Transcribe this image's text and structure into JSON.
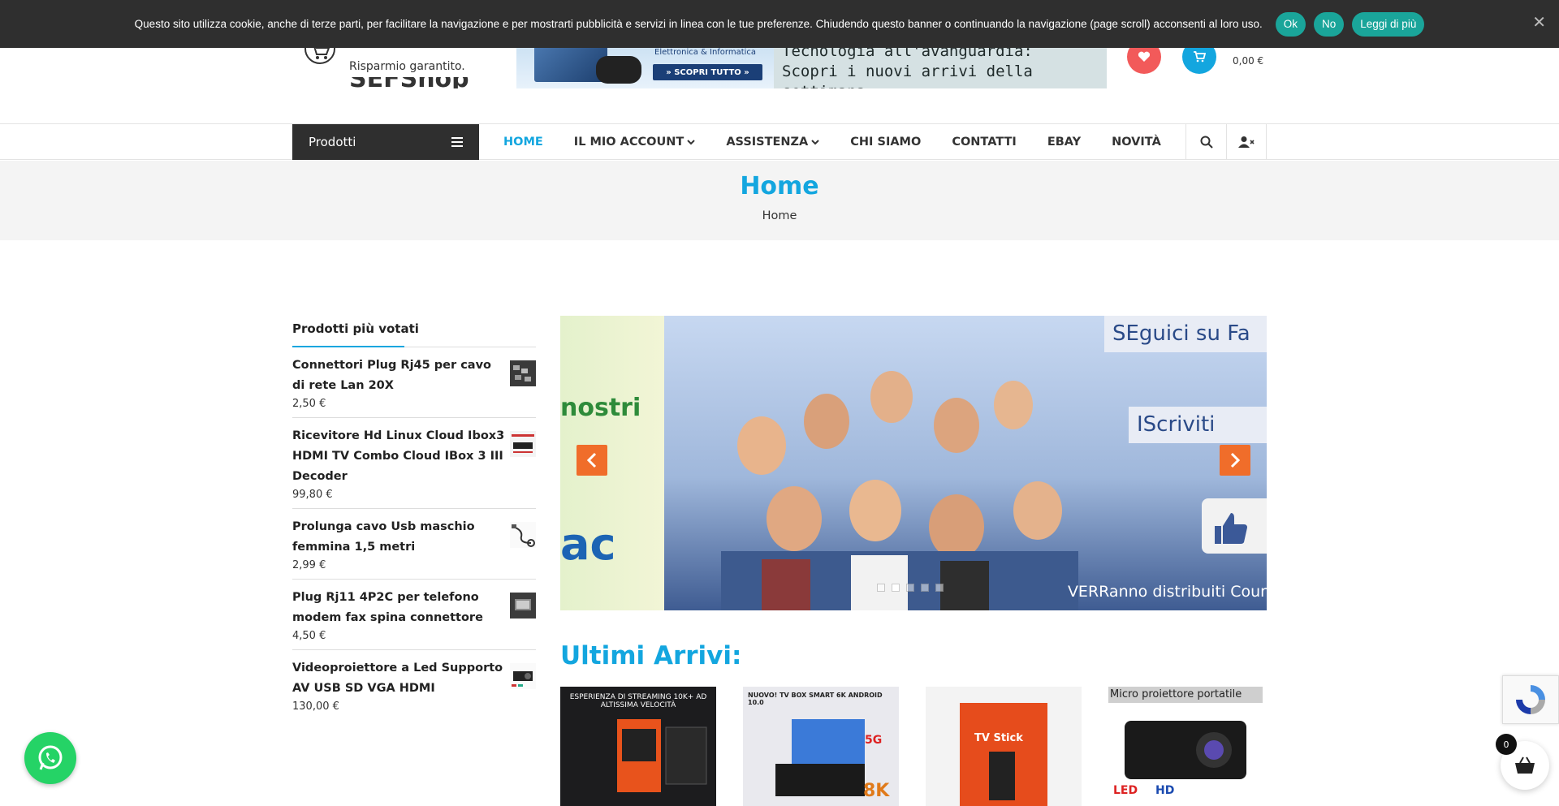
{
  "cookie": {
    "message": "Questo sito utilizza cookie, anche di terze parti, per facilitare la navigazione e per mostrarti pubblicità e servizi in linea con le tue preferenze. Chiudendo questo banner o continuando la navigazione (page scroll) acconsenti al loro uso.",
    "ok_label": "Ok",
    "no_label": "No",
    "more_label": "Leggi di più",
    "close_glyph": "✕",
    "accent": "#1aa59a"
  },
  "header": {
    "site_name": "SEFShop",
    "tagline": "Risparmio garantito.",
    "banner": {
      "category": "Elettronica & Informatica",
      "cta": "» SCOPRI TUTTO »",
      "line1": "Tecnologia all'avanguardia:",
      "line2": "Scopri i nuovi arrivi della settimana."
    },
    "cart_total": "0,00 €",
    "wishlist_color": "#f25a5a",
    "cart_color": "#13a6df"
  },
  "nav": {
    "category_label": "Prodotti",
    "items": [
      {
        "label": "HOME",
        "active": true
      },
      {
        "label": "IL MIO ACCOUNT",
        "dropdown": true
      },
      {
        "label": "ASSISTENZA",
        "dropdown": true
      },
      {
        "label": "CHI SIAMO"
      },
      {
        "label": "CONTATTI"
      },
      {
        "label": "EBAY"
      },
      {
        "label": "NOVITÀ"
      }
    ],
    "accent": "#13a6df"
  },
  "page": {
    "title": "Home",
    "breadcrumb": "Home"
  },
  "sidebar": {
    "title": "Prodotti più votati",
    "products": [
      {
        "name": "Connettori Plug Rj45 per cavo di rete Lan 20X",
        "price": "2,50 €"
      },
      {
        "name": "Ricevitore Hd Linux Cloud Ibox3 HDMI TV Combo Cloud IBox 3 III Decoder",
        "price": "99,80 €"
      },
      {
        "name": "Prolunga cavo Usb maschio femmina 1,5 metri",
        "price": "2,99 €"
      },
      {
        "name": "Plug Rj11 4P2C per telefono modem fax spina connettore",
        "price": "4,50 €"
      },
      {
        "name": "Videoproiettore a Led Supporto AV USB SD VGA HDMI",
        "price": "130,00 €"
      }
    ]
  },
  "slider": {
    "prev_text1": "nostri",
    "prev_text2": "ac",
    "fb_line1": "SEguici su Fa",
    "fb_line2": "IScriviti",
    "fb_bottom": "VERRanno distribuiti Cour",
    "fb_like": "Mi",
    "arrow_color": "#f06d2a",
    "slide_count": 5,
    "active_slide": 2
  },
  "latest": {
    "title": "Ultimi Arrivi:",
    "cards": [
      {
        "caption": "ESPERIENZA DI STREAMING 10K+ AD ALTISSIMA VELOCITÀ"
      },
      {
        "caption": "NUOVO! TV BOX SMART 6K ANDROID 10.0"
      },
      {
        "caption": "TV Stick"
      },
      {
        "caption": "Micro proiettore portatile"
      }
    ]
  },
  "floating": {
    "basket_count": "0",
    "whatsapp_color": "#25d366"
  }
}
